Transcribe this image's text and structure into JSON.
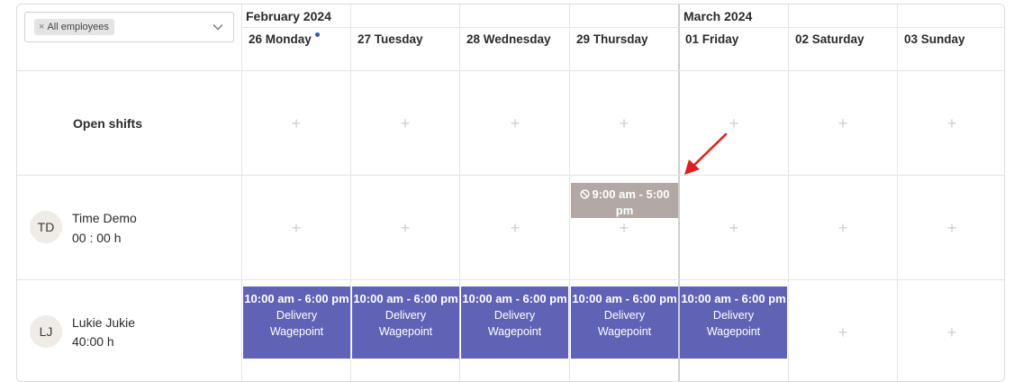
{
  "filter": {
    "chip_label": "All employees"
  },
  "months": [
    "February 2024",
    "March 2024"
  ],
  "days": [
    "26 Monday",
    "27 Tuesday",
    "28 Wednesday",
    "29 Thursday",
    "01 Friday",
    "02 Saturday",
    "03 Sunday"
  ],
  "open_shifts_label": "Open shifts",
  "employees": [
    {
      "initials": "TD",
      "name": "Time Demo",
      "hours": "00 : 00 h"
    },
    {
      "initials": "LJ",
      "name": "Lukie Jukie",
      "hours": "40:00 h"
    }
  ],
  "unavailable_shift": {
    "time": "9:00 am - 5:00 pm"
  },
  "lukie_shifts": [
    {
      "time": "10:00 am - 6:00 pm",
      "role": "Delivery",
      "location": "Wagepoint"
    },
    {
      "time": "10:00 am - 6:00 pm",
      "role": "Delivery",
      "location": "Wagepoint"
    },
    {
      "time": "10:00 am - 6:00 pm",
      "role": "Delivery",
      "location": "Wagepoint"
    },
    {
      "time": "10:00 am - 6:00 pm",
      "role": "Delivery",
      "location": "Wagepoint"
    },
    {
      "time": "10:00 am - 6:00 pm",
      "role": "Delivery",
      "location": "Wagepoint"
    }
  ],
  "colors": {
    "shift": "#6063b5",
    "unavailable": "#b2a9a6",
    "today_dot": "#2f5bb7",
    "annotation_arrow": "#e01e1e"
  },
  "icons": [
    "close-icon",
    "chevron-down-icon",
    "plus-icon",
    "ban-icon",
    "annotation-arrow"
  ]
}
